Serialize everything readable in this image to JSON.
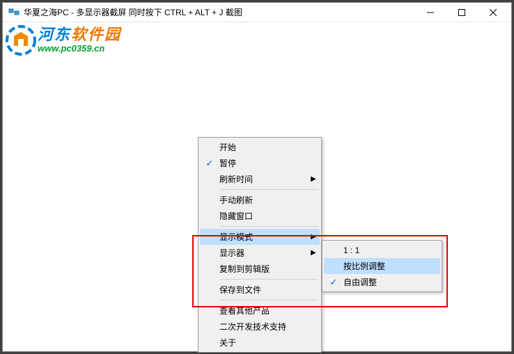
{
  "window": {
    "title": "华夏之海PC - 多显示器截屏   同时按下 CTRL + ALT + J 截图"
  },
  "watermark": {
    "cn_part1": "河东",
    "cn_part2": "软件园",
    "url": "www.pc0359.cn"
  },
  "menu1": {
    "items": [
      {
        "label": "开始",
        "checked": false,
        "arrow": false
      },
      {
        "label": "暂停",
        "checked": true,
        "arrow": false
      },
      {
        "label": "刷新时间",
        "checked": false,
        "arrow": true
      }
    ],
    "group2": [
      {
        "label": "手动刷新",
        "checked": false,
        "arrow": false
      },
      {
        "label": "隐藏窗口",
        "checked": false,
        "arrow": false
      }
    ],
    "group3": [
      {
        "label": "显示模式",
        "checked": false,
        "arrow": true,
        "hl": true
      },
      {
        "label": "显示器",
        "checked": false,
        "arrow": true
      },
      {
        "label": "复制到剪辑版",
        "checked": false,
        "arrow": false
      }
    ],
    "group4": [
      {
        "label": "保存到文件",
        "checked": false,
        "arrow": false
      }
    ],
    "group5": [
      {
        "label": "查看其他产品",
        "checked": false,
        "arrow": false
      },
      {
        "label": "二次开发技术支持",
        "checked": false,
        "arrow": false
      },
      {
        "label": "关于",
        "checked": false,
        "arrow": false
      }
    ]
  },
  "menu2": {
    "items": [
      {
        "label": "1 : 1",
        "checked": false,
        "hl": false
      },
      {
        "label": "按比例调整",
        "checked": false,
        "hl": true
      },
      {
        "label": "自由调整",
        "checked": true,
        "hl": false
      }
    ]
  }
}
